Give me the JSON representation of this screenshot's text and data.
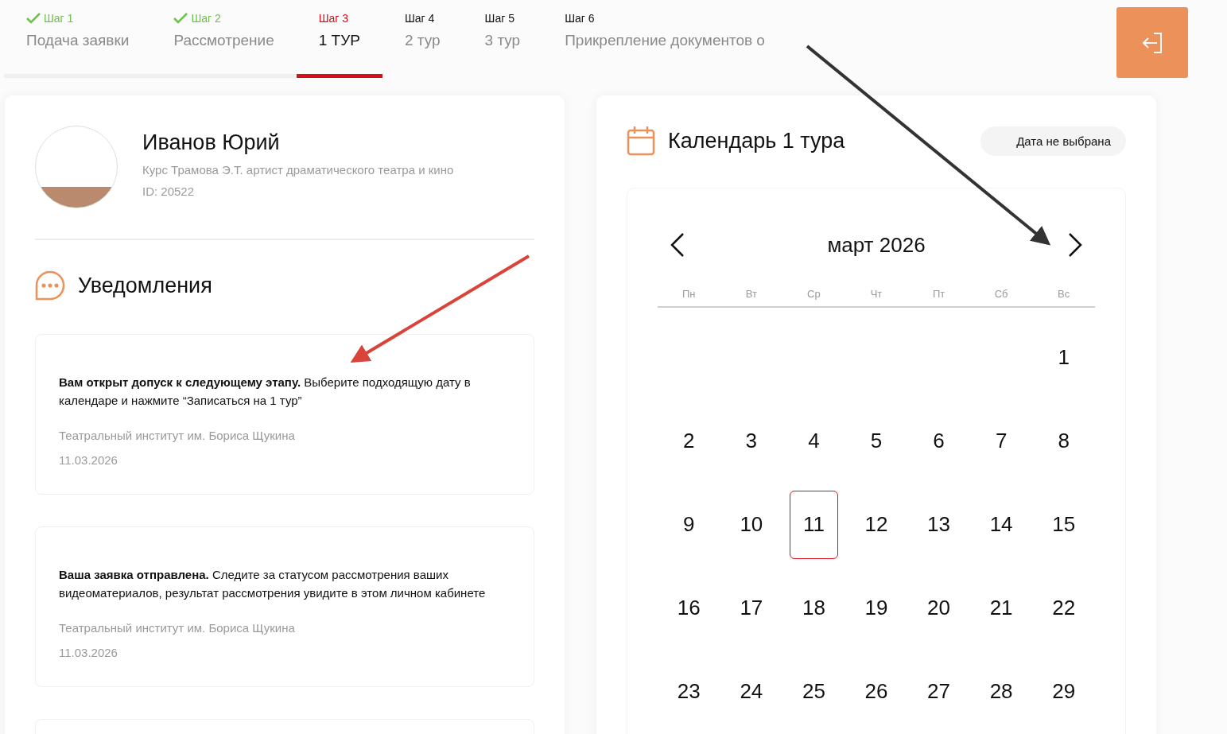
{
  "steps": [
    {
      "number": "Шаг 1",
      "label": "Подача заявки",
      "completed": true,
      "selected": false
    },
    {
      "number": "Шаг 2",
      "label": "Рассмотрение",
      "completed": true,
      "selected": false
    },
    {
      "number": "Шаг 3",
      "label": "1 ТУР",
      "completed": false,
      "selected": true
    },
    {
      "number": "Шаг 4",
      "label": "2 тур",
      "completed": false,
      "selected": false
    },
    {
      "number": "Шаг 5",
      "label": "3 тур",
      "completed": false,
      "selected": false
    },
    {
      "number": "Шаг 6",
      "label": "Прикрепление документов о",
      "completed": false,
      "selected": false
    }
  ],
  "profile": {
    "name": "Иванов Юрий",
    "course": "Курс Трамова Э.Т. артист драматического театра и кино",
    "id": "ID: 20522"
  },
  "notifications": {
    "title": "Уведомления",
    "items": [
      {
        "text": "**Вам открыт допуск к следующему этапу.** Выберите подходящую дату в календаре и нажмите “Записаться на 1 тур”",
        "sender": "Театральный институт им. Бориса Щукина",
        "date": "11.03.2026"
      },
      {
        "text": "**Ваша заявка отправлена.** Следите за статусом рассмотрения ваших видеоматериалов, результат рассмотрения увидите в этом личном кабинете",
        "sender": "Театральный институт им. Бориса Щукина",
        "date": "11.03.2026"
      }
    ]
  },
  "calendar": {
    "title": "Календарь 1 тура",
    "date_status": "Дата не выбрана",
    "month": "март 2026",
    "weekdays": [
      "Пн",
      "Вт",
      "Ср",
      "Чт",
      "Пт",
      "Сб",
      "Вс"
    ],
    "weeks": [
      [
        {
          "label": "1",
          "selected": false
        }
      ],
      [
        {
          "label": "2",
          "selected": false
        },
        {
          "label": "3",
          "selected": false
        },
        {
          "label": "4",
          "selected": false
        },
        {
          "label": "5",
          "selected": false
        },
        {
          "label": "6",
          "selected": false
        },
        {
          "label": "7",
          "selected": false
        },
        {
          "label": "8",
          "selected": false
        }
      ],
      [
        {
          "label": "9",
          "selected": false
        },
        {
          "label": "10",
          "selected": false
        },
        {
          "label": "11",
          "selected": true
        },
        {
          "label": "12",
          "selected": false
        },
        {
          "label": "13",
          "selected": false
        },
        {
          "label": "14",
          "selected": false
        },
        {
          "label": "15",
          "selected": false
        }
      ],
      [
        {
          "label": "16",
          "selected": false
        },
        {
          "label": "17",
          "selected": false
        },
        {
          "label": "18",
          "selected": false
        },
        {
          "label": "19",
          "selected": false
        },
        {
          "label": "20",
          "selected": false
        },
        {
          "label": "21",
          "selected": false
        },
        {
          "label": "22",
          "selected": false
        }
      ],
      [
        {
          "label": "23",
          "selected": false
        },
        {
          "label": "24",
          "selected": false
        },
        {
          "label": "25",
          "selected": false
        },
        {
          "label": "26",
          "selected": false
        },
        {
          "label": "27",
          "selected": false
        },
        {
          "label": "28",
          "selected": false
        },
        {
          "label": "29",
          "selected": false
        }
      ]
    ]
  }
}
